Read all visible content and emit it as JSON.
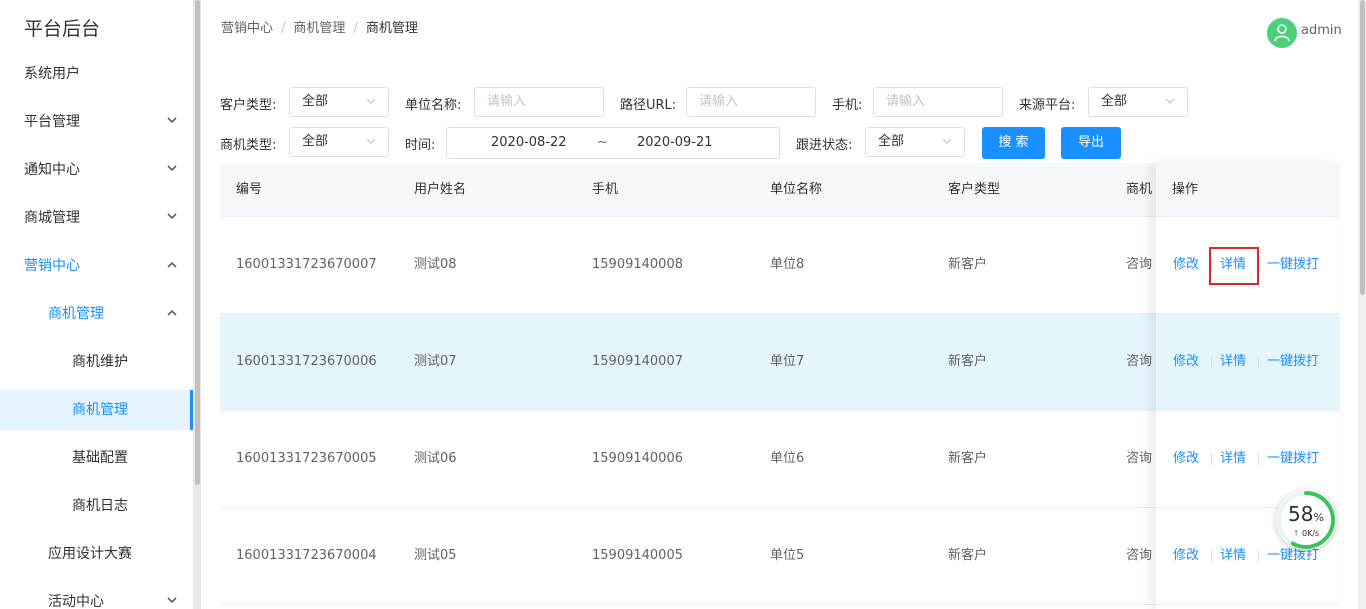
{
  "sidebar": {
    "brand": "平台后台",
    "items": [
      {
        "label": "系统用户"
      },
      {
        "label": "平台管理"
      },
      {
        "label": "通知中心"
      },
      {
        "label": "商城管理"
      },
      {
        "label": "营销中心"
      },
      {
        "label": "商机管理"
      },
      {
        "label": "商机维护"
      },
      {
        "label": "商机管理"
      },
      {
        "label": "基础配置"
      },
      {
        "label": "商机日志"
      },
      {
        "label": "应用设计大赛"
      },
      {
        "label": "活动中心"
      }
    ]
  },
  "header": {
    "breadcrumb": [
      "营销中心",
      "商机管理",
      "商机管理"
    ],
    "breadcrumb_sep": "/",
    "username": "admin"
  },
  "filters": {
    "customer_type": {
      "label": "客户类型:",
      "value": "全部"
    },
    "unit_name": {
      "label": "单位名称:",
      "placeholder": "请输入"
    },
    "path_url": {
      "label": "路径URL:",
      "placeholder": "请输入"
    },
    "phone": {
      "label": "手机:",
      "placeholder": "请输入"
    },
    "source_platform": {
      "label": "来源平台:",
      "value": "全部"
    },
    "opportunity_type": {
      "label": "商机类型:",
      "value": "全部"
    },
    "time": {
      "label": "时间:",
      "start": "2020-08-22",
      "sep": "~",
      "end": "2020-09-21"
    },
    "follow_status": {
      "label": "跟进状态:",
      "value": "全部"
    },
    "search_label": "搜 索",
    "export_label": "导出"
  },
  "table": {
    "columns": [
      "编号",
      "用户姓名",
      "手机",
      "单位名称",
      "客户类型",
      "商机"
    ],
    "op_column": "操作",
    "rows": [
      {
        "id": "16001331723670007",
        "name": "测试08",
        "phone": "15909140008",
        "unit": "单位8",
        "ctype": "新客户",
        "otype": "咨询"
      },
      {
        "id": "16001331723670006",
        "name": "测试07",
        "phone": "15909140007",
        "unit": "单位7",
        "ctype": "新客户",
        "otype": "咨询"
      },
      {
        "id": "16001331723670005",
        "name": "测试06",
        "phone": "15909140006",
        "unit": "单位6",
        "ctype": "新客户",
        "otype": "咨询"
      },
      {
        "id": "16001331723670004",
        "name": "测试05",
        "phone": "15909140005",
        "unit": "单位5",
        "ctype": "新客户",
        "otype": "咨询"
      }
    ],
    "ops": {
      "edit": "修改",
      "detail": "详情",
      "call": "一键拨打"
    }
  },
  "speed_widget": {
    "percent": "58",
    "percent_unit": "%",
    "rate": "0K/s",
    "ring_fraction": 0.58
  },
  "colors": {
    "accent": "#1890ff",
    "highlight_row": "#e5f5fc",
    "callout": "#e0262b",
    "avatar": "#4cd07d"
  }
}
